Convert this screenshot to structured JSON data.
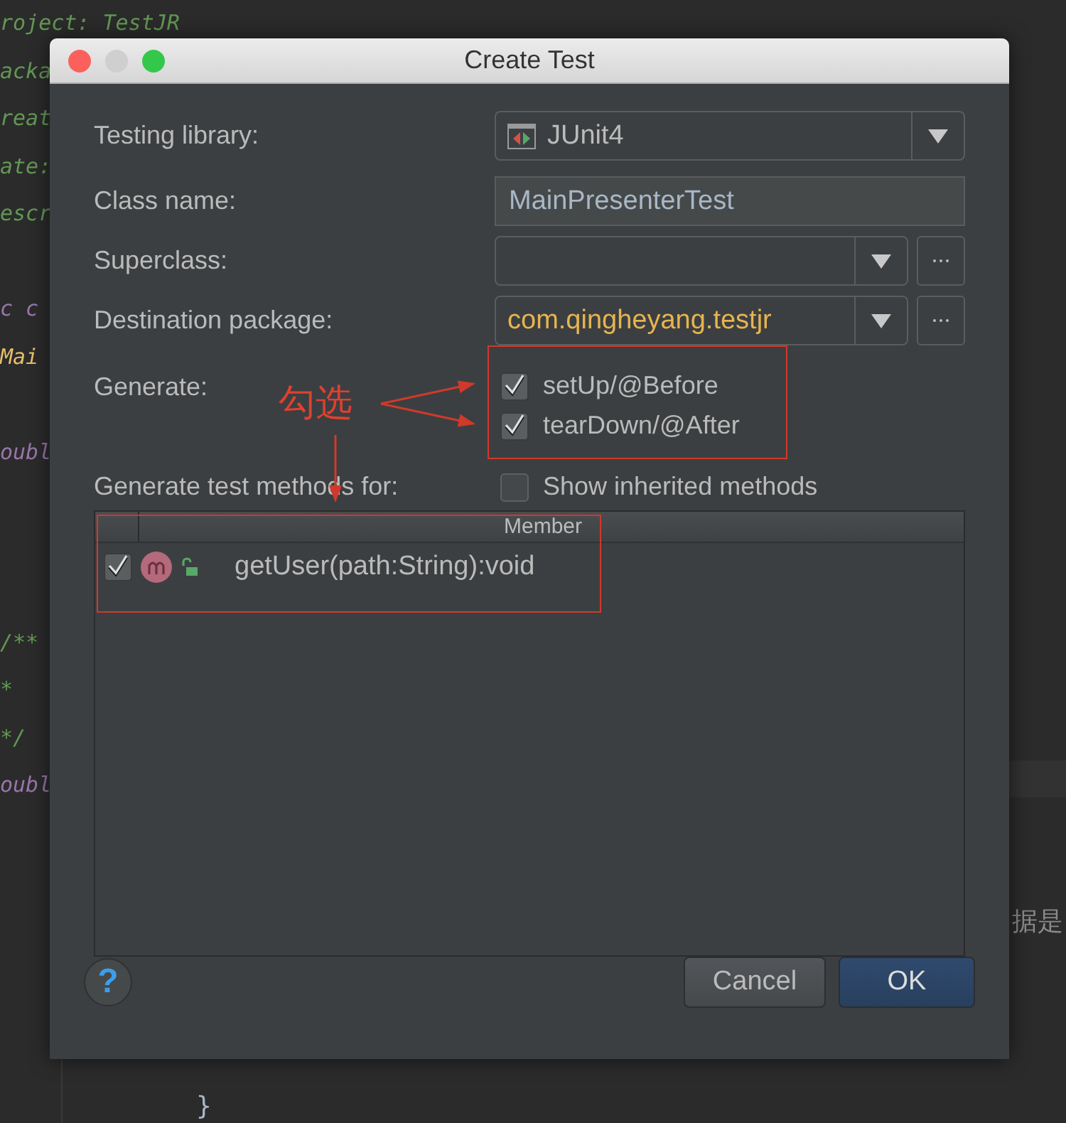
{
  "editor": {
    "lines": [
      {
        "text": "roject: TestJR",
        "kind": "comment"
      },
      {
        "text": "acka",
        "kind": "comment"
      },
      {
        "text": "reat",
        "kind": "comment"
      },
      {
        "text": "ate:",
        "kind": "comment"
      },
      {
        "text": "escr",
        "kind": "comment"
      },
      {
        "kind": "blank"
      },
      {
        "text": "c c",
        "kind": "keyword"
      },
      {
        "text": "Mai",
        "kind": "type"
      },
      {
        "kind": "blank"
      },
      {
        "text": "oubl",
        "kind": "keyword"
      },
      {
        "kind": "blank"
      },
      {
        "kind": "blank"
      },
      {
        "kind": "blank"
      },
      {
        "text": "/**",
        "kind": "comment"
      },
      {
        "text": "*",
        "kind": "comment"
      },
      {
        "text": "*/",
        "kind": "comment"
      },
      {
        "text": "oubl",
        "kind": "keyword"
      }
    ],
    "right_text": "据是",
    "bottom_text": "}"
  },
  "dialog": {
    "title": "Create Test",
    "fields": [
      {
        "label": "Testing library:",
        "kind": "library",
        "value": "JUnit4"
      },
      {
        "label": "Class name:",
        "kind": "text",
        "value": "MainPresenterTest"
      },
      {
        "label": "Superclass:",
        "kind": "class"
      },
      {
        "label": "Destination package:",
        "kind": "package",
        "value": "com.qingheyang.testjr"
      }
    ],
    "generate": {
      "label": "Generate:",
      "options": [
        {
          "label": "setUp/@Before",
          "checked": true
        },
        {
          "label": "tearDown/@After",
          "checked": true
        }
      ]
    },
    "methods": {
      "label": "Generate test methods for:",
      "show_inherited": {
        "label": "Show inherited methods",
        "checked": false
      },
      "table": {
        "columns": [
          "Member"
        ],
        "rows": [
          {
            "checked": true,
            "method": "getUser(path:String):void"
          }
        ]
      }
    },
    "help": {
      "label": "?"
    },
    "buttons": [
      {
        "label": "Cancel",
        "default": false
      },
      {
        "label": "OK",
        "default": true
      }
    ]
  },
  "annotation": {
    "text": "勾选"
  }
}
